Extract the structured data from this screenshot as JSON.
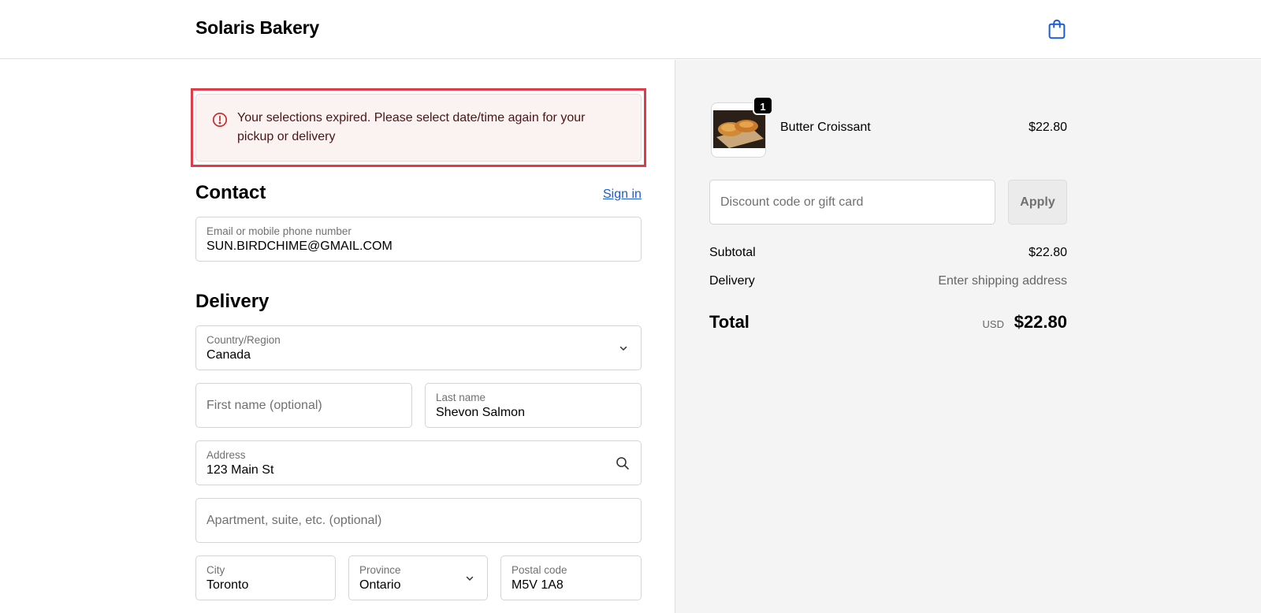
{
  "header": {
    "brand": "Solaris Bakery",
    "cart_icon": "shopping-bag-icon"
  },
  "alert": {
    "icon": "alert-circle-icon",
    "message": "Your selections expired. Please select date/time again for your pickup or delivery"
  },
  "contact": {
    "title": "Contact",
    "sign_in": "Sign in",
    "email": {
      "label": "Email or mobile phone number",
      "value": "SUN.BIRDCHIME@GMAIL.COM"
    }
  },
  "delivery": {
    "title": "Delivery",
    "country": {
      "label": "Country/Region",
      "value": "Canada"
    },
    "first_name": {
      "placeholder": "First name (optional)"
    },
    "last_name": {
      "label": "Last name",
      "value": "Shevon Salmon"
    },
    "address": {
      "label": "Address",
      "value": "123 Main St"
    },
    "apartment": {
      "placeholder": "Apartment, suite, etc. (optional)"
    },
    "city": {
      "label": "City",
      "value": "Toronto"
    },
    "province": {
      "label": "Province",
      "value": "Ontario"
    },
    "postal": {
      "label": "Postal code",
      "value": "M5V 1A8"
    }
  },
  "summary": {
    "item": {
      "name": "Butter Croissant",
      "price": "$22.80",
      "quantity": "1"
    },
    "discount": {
      "placeholder": "Discount code or gift card",
      "apply": "Apply"
    },
    "subtotal": {
      "label": "Subtotal",
      "value": "$22.80"
    },
    "delivery": {
      "label": "Delivery",
      "value": "Enter shipping address"
    },
    "total": {
      "label": "Total",
      "currency": "USD",
      "value": "$22.80"
    }
  },
  "colors": {
    "accent": "#1c5bd6",
    "alert_border": "#e03c48",
    "alert_bg": "#fbf2f2"
  }
}
